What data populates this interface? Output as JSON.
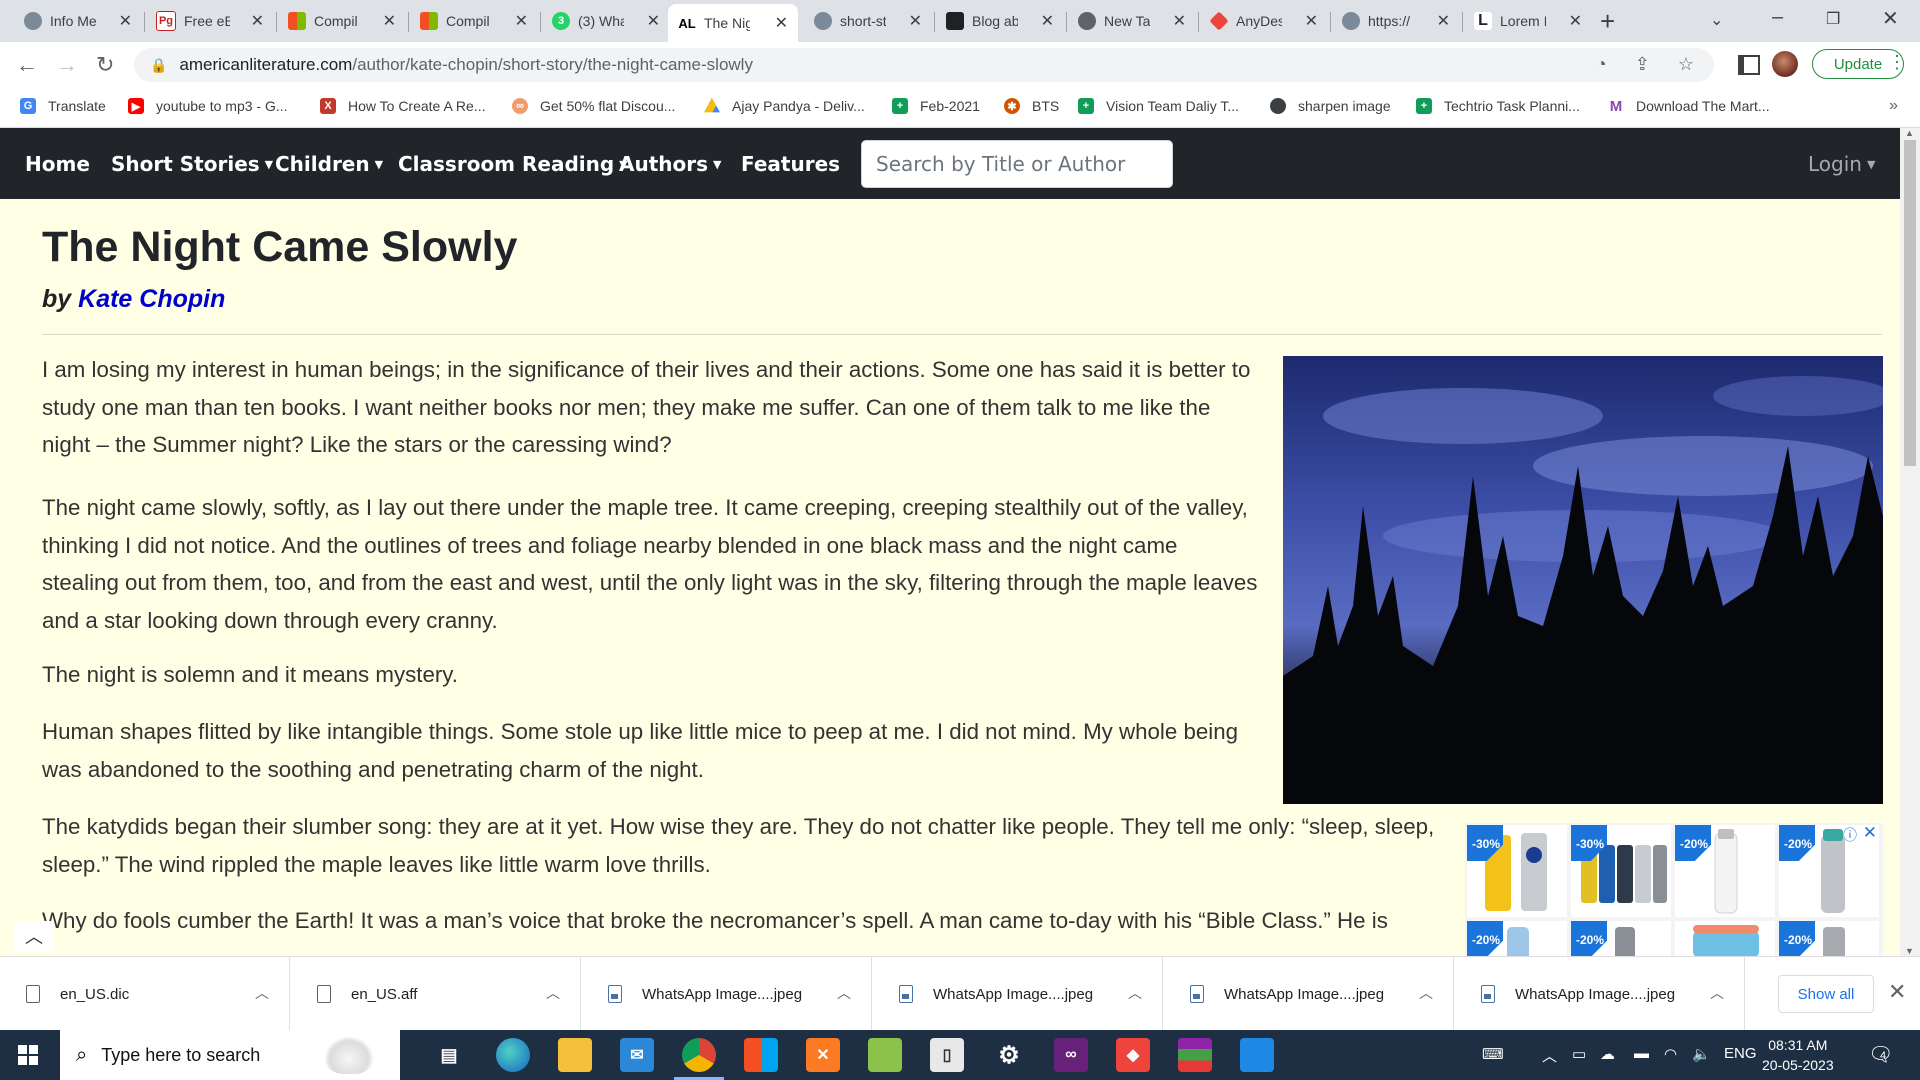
{
  "tabs": [
    {
      "label": "Info Me",
      "icon": "globe-icon",
      "color": "#5f6368"
    },
    {
      "label": "Free eB",
      "icon": "pg-icon",
      "color": "#c5221f"
    },
    {
      "label": "Compil",
      "icon": "ms-icon",
      "color": "#f25022"
    },
    {
      "label": "Compil",
      "icon": "ms-icon",
      "color": "#f25022"
    },
    {
      "label": "(3) Wha",
      "icon": "whatsapp-icon",
      "color": "#25d366"
    },
    {
      "label": "The Nig",
      "icon": "al-icon",
      "color": "#000000"
    },
    {
      "label": "short-st",
      "icon": "globe-icon",
      "color": "#5f6368"
    },
    {
      "label": "Blog ab",
      "icon": "blog-icon",
      "color": "#202124"
    },
    {
      "label": "New Tal",
      "icon": "chrome-icon",
      "color": "#5f6368"
    },
    {
      "label": "AnyDes",
      "icon": "anydesk-icon",
      "color": "#ef443b"
    },
    {
      "label": "https://",
      "icon": "globe-icon",
      "color": "#5f6368"
    },
    {
      "label": "Lorem I",
      "icon": "lorem-icon",
      "color": "#202124"
    }
  ],
  "address": {
    "host": "americanliterature.com",
    "path": "/author/kate-chopin/short-story/the-night-came-slowly",
    "update_label": "Update"
  },
  "bookmarks": [
    {
      "label": "Translate",
      "color": "#4285f4"
    },
    {
      "label": "youtube to mp3 - G...",
      "color": "#ff0000"
    },
    {
      "label": "How To Create A Re...",
      "color": "#c0392b"
    },
    {
      "label": "Get 50% flat Discou...",
      "color": "#f39c6b"
    },
    {
      "label": "Ajay Pandya - Deliv...",
      "color": "#fbbc04"
    },
    {
      "label": "Feb-2021",
      "color": "#0f9d58"
    },
    {
      "label": "BTS",
      "color": "#d35400"
    },
    {
      "label": "Vision Team Daliy T...",
      "color": "#0f9d58"
    },
    {
      "label": "sharpen image",
      "color": "#3c4043"
    },
    {
      "label": "Techtrio Task Planni...",
      "color": "#0f9d58"
    },
    {
      "label": "Download The Mart...",
      "color": "#8e44ad"
    }
  ],
  "nav": {
    "items": [
      "Home",
      "Short Stories",
      "Children",
      "Classroom Reading",
      "Authors",
      "Features"
    ],
    "search_placeholder": "Search by Title or Author",
    "login": "Login"
  },
  "story": {
    "title": "The Night Came Slowly",
    "by": "by",
    "author": "Kate Chopin",
    "paragraphs": [
      [
        "I am losing my interest in human beings; in the significance of their lives and their actions. Some one has said it is better to",
        "study one man than ten books. I want neither books nor men; they make me suffer. Can one of them talk to me like the",
        "night – the Summer night? Like the stars or the caressing wind?"
      ],
      [
        "The night came slowly, softly, as I lay out there under the maple tree. It came creeping, creeping stealthily out of the valley,",
        "thinking I did not notice. And the outlines of trees and foliage nearby blended in one black mass and the night came",
        "stealing out from them, too, and from the east and west, until the only light was in the sky, filtering through the maple leaves",
        "and a star looking down through every cranny."
      ],
      [
        "The night is solemn and it means mystery."
      ],
      [
        "Human shapes flitted by like intangible things. Some stole up like little mice to peep at me. I did not mind. My whole being",
        "was abandoned to the soothing and penetrating charm of the night."
      ],
      [
        "The katydids began their slumber song: they are at it yet. How wise they are. They do not chatter like people. They tell me only: “sleep, sleep,",
        "sleep.” The wind rippled the maple leaves like little warm love thrills."
      ],
      [
        "Why do fools cumber the Earth! It was a man’s voice that broke the necromancer’s spell. A man came to-day with his “Bible Class.” He is"
      ]
    ]
  },
  "ad": {
    "badges": [
      "-30%",
      "-30%",
      "-20%",
      "-20%",
      "-20%",
      "-20%",
      "-20%"
    ]
  },
  "downloads": [
    {
      "name": "en_US.dic",
      "type": "file"
    },
    {
      "name": "en_US.aff",
      "type": "file"
    },
    {
      "name": "WhatsApp Image....jpeg",
      "type": "image"
    },
    {
      "name": "WhatsApp Image....jpeg",
      "type": "image"
    },
    {
      "name": "WhatsApp Image....jpeg",
      "type": "image"
    },
    {
      "name": "WhatsApp Image....jpeg",
      "type": "image"
    }
  ],
  "downloads_show_all": "Show all",
  "taskbar": {
    "search_text": "Type here to search",
    "language": "ENG",
    "time": "08:31 AM",
    "date": "20-05-2023",
    "notifications": "4"
  }
}
